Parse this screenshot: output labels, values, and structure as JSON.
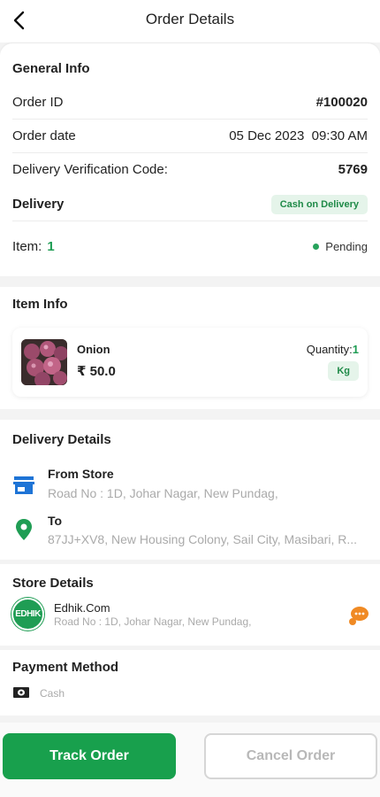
{
  "header": {
    "title": "Order Details",
    "back_icon": "chevron-left-icon"
  },
  "general_info": {
    "title": "General Info",
    "order_id_label": "Order ID",
    "order_id": "#100020",
    "order_date_label": "Order date",
    "order_date": "05 Dec 2023  09:30 AM",
    "verification_label": "Delivery Verification Code:",
    "verification_code": "5769",
    "delivery_label": "Delivery",
    "payment_badge": "Cash on Delivery",
    "item_label": "Item:",
    "item_count": "1",
    "status": "Pending",
    "status_color": "#27a35c"
  },
  "item_info": {
    "title": "Item Info",
    "name": "Onion",
    "price": "₹ 50.0",
    "quantity_label": "Quantity:",
    "quantity": "1",
    "unit": "Kg"
  },
  "delivery_details": {
    "title": "Delivery Details",
    "from_label": "From Store",
    "from_address": "Road No : 1D, Johar Nagar, New Pundag,",
    "to_label": "To",
    "to_address": "87JJ+XV8, New Housing Colony, Sail City, Masibari, R..."
  },
  "store_details": {
    "title": "Store Details",
    "logo_text": "EDHIK",
    "name": "Edhik.Com",
    "address": "Road No : 1D, Johar Nagar, New Pundag,"
  },
  "payment": {
    "title": "Payment Method",
    "method": "Cash"
  },
  "actions": {
    "track": "Track Order",
    "cancel": "Cancel Order"
  },
  "colors": {
    "accent": "#18a04d",
    "store_icon": "#1e74d6",
    "location_pin": "#1f9d54",
    "chat": "#f08a24"
  }
}
